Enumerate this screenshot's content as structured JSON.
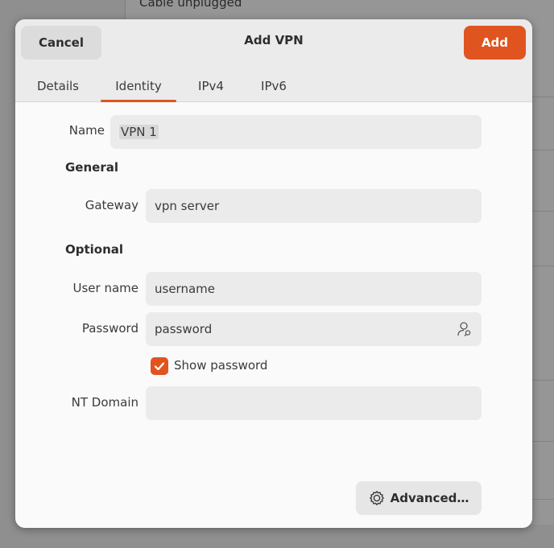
{
  "background": {
    "status_text": "Cable unplugged"
  },
  "dialog": {
    "title": "Add VPN",
    "cancel_label": "Cancel",
    "add_label": "Add",
    "tabs": [
      {
        "label": "Details"
      },
      {
        "label": "Identity",
        "active": true
      },
      {
        "label": "IPv4"
      },
      {
        "label": "IPv6"
      }
    ]
  },
  "form": {
    "name_label": "Name",
    "name_value": "VPN 1",
    "general_heading": "General",
    "gateway_label": "Gateway",
    "gateway_value": "vpn server",
    "optional_heading": "Optional",
    "username_label": "User name",
    "username_value": "username",
    "password_label": "Password",
    "password_value": "password",
    "password_icon": "user-key-icon",
    "show_password_label": "Show password",
    "show_password_checked": true,
    "nt_domain_label": "NT Domain",
    "nt_domain_value": "",
    "advanced_label": "Advanced…",
    "advanced_icon": "gear-icon"
  },
  "colors": {
    "accent": "#e05420"
  }
}
